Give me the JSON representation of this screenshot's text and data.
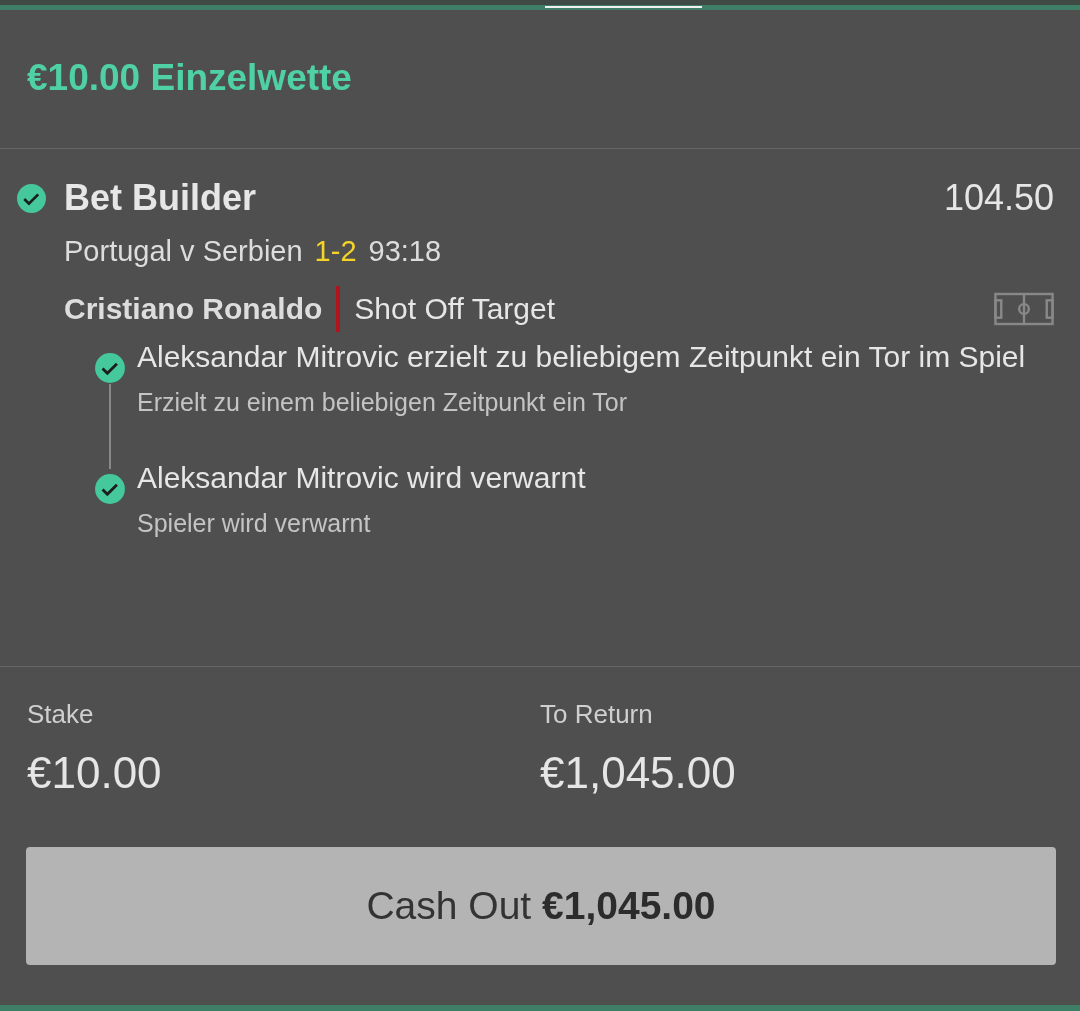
{
  "title": "€10.00 Einzelwette",
  "bet": {
    "name": "Bet Builder",
    "settled": true,
    "odds": "104.50",
    "match": "Portugal v Serbien",
    "score": "1-2",
    "clock": "93:18",
    "player": "Cristiano Ronaldo",
    "market": "Shot Off Target"
  },
  "selections": [
    {
      "name": "Aleksandar Mitrovic erzielt zu beliebigem Zeitpunkt ein Tor im Spiel",
      "description": "Erzielt zu einem beliebigen Zeitpunkt ein Tor",
      "checked": true
    },
    {
      "name": "Aleksandar Mitrovic wird verwarnt",
      "description": "Spieler wird verwarnt",
      "checked": true
    }
  ],
  "stake": {
    "label": "Stake",
    "value": "€10.00"
  },
  "to_return": {
    "label": "To Return",
    "value": "€1,045.00"
  },
  "cash_out": {
    "label": "Cash Out",
    "amount": "€1,045.00"
  }
}
